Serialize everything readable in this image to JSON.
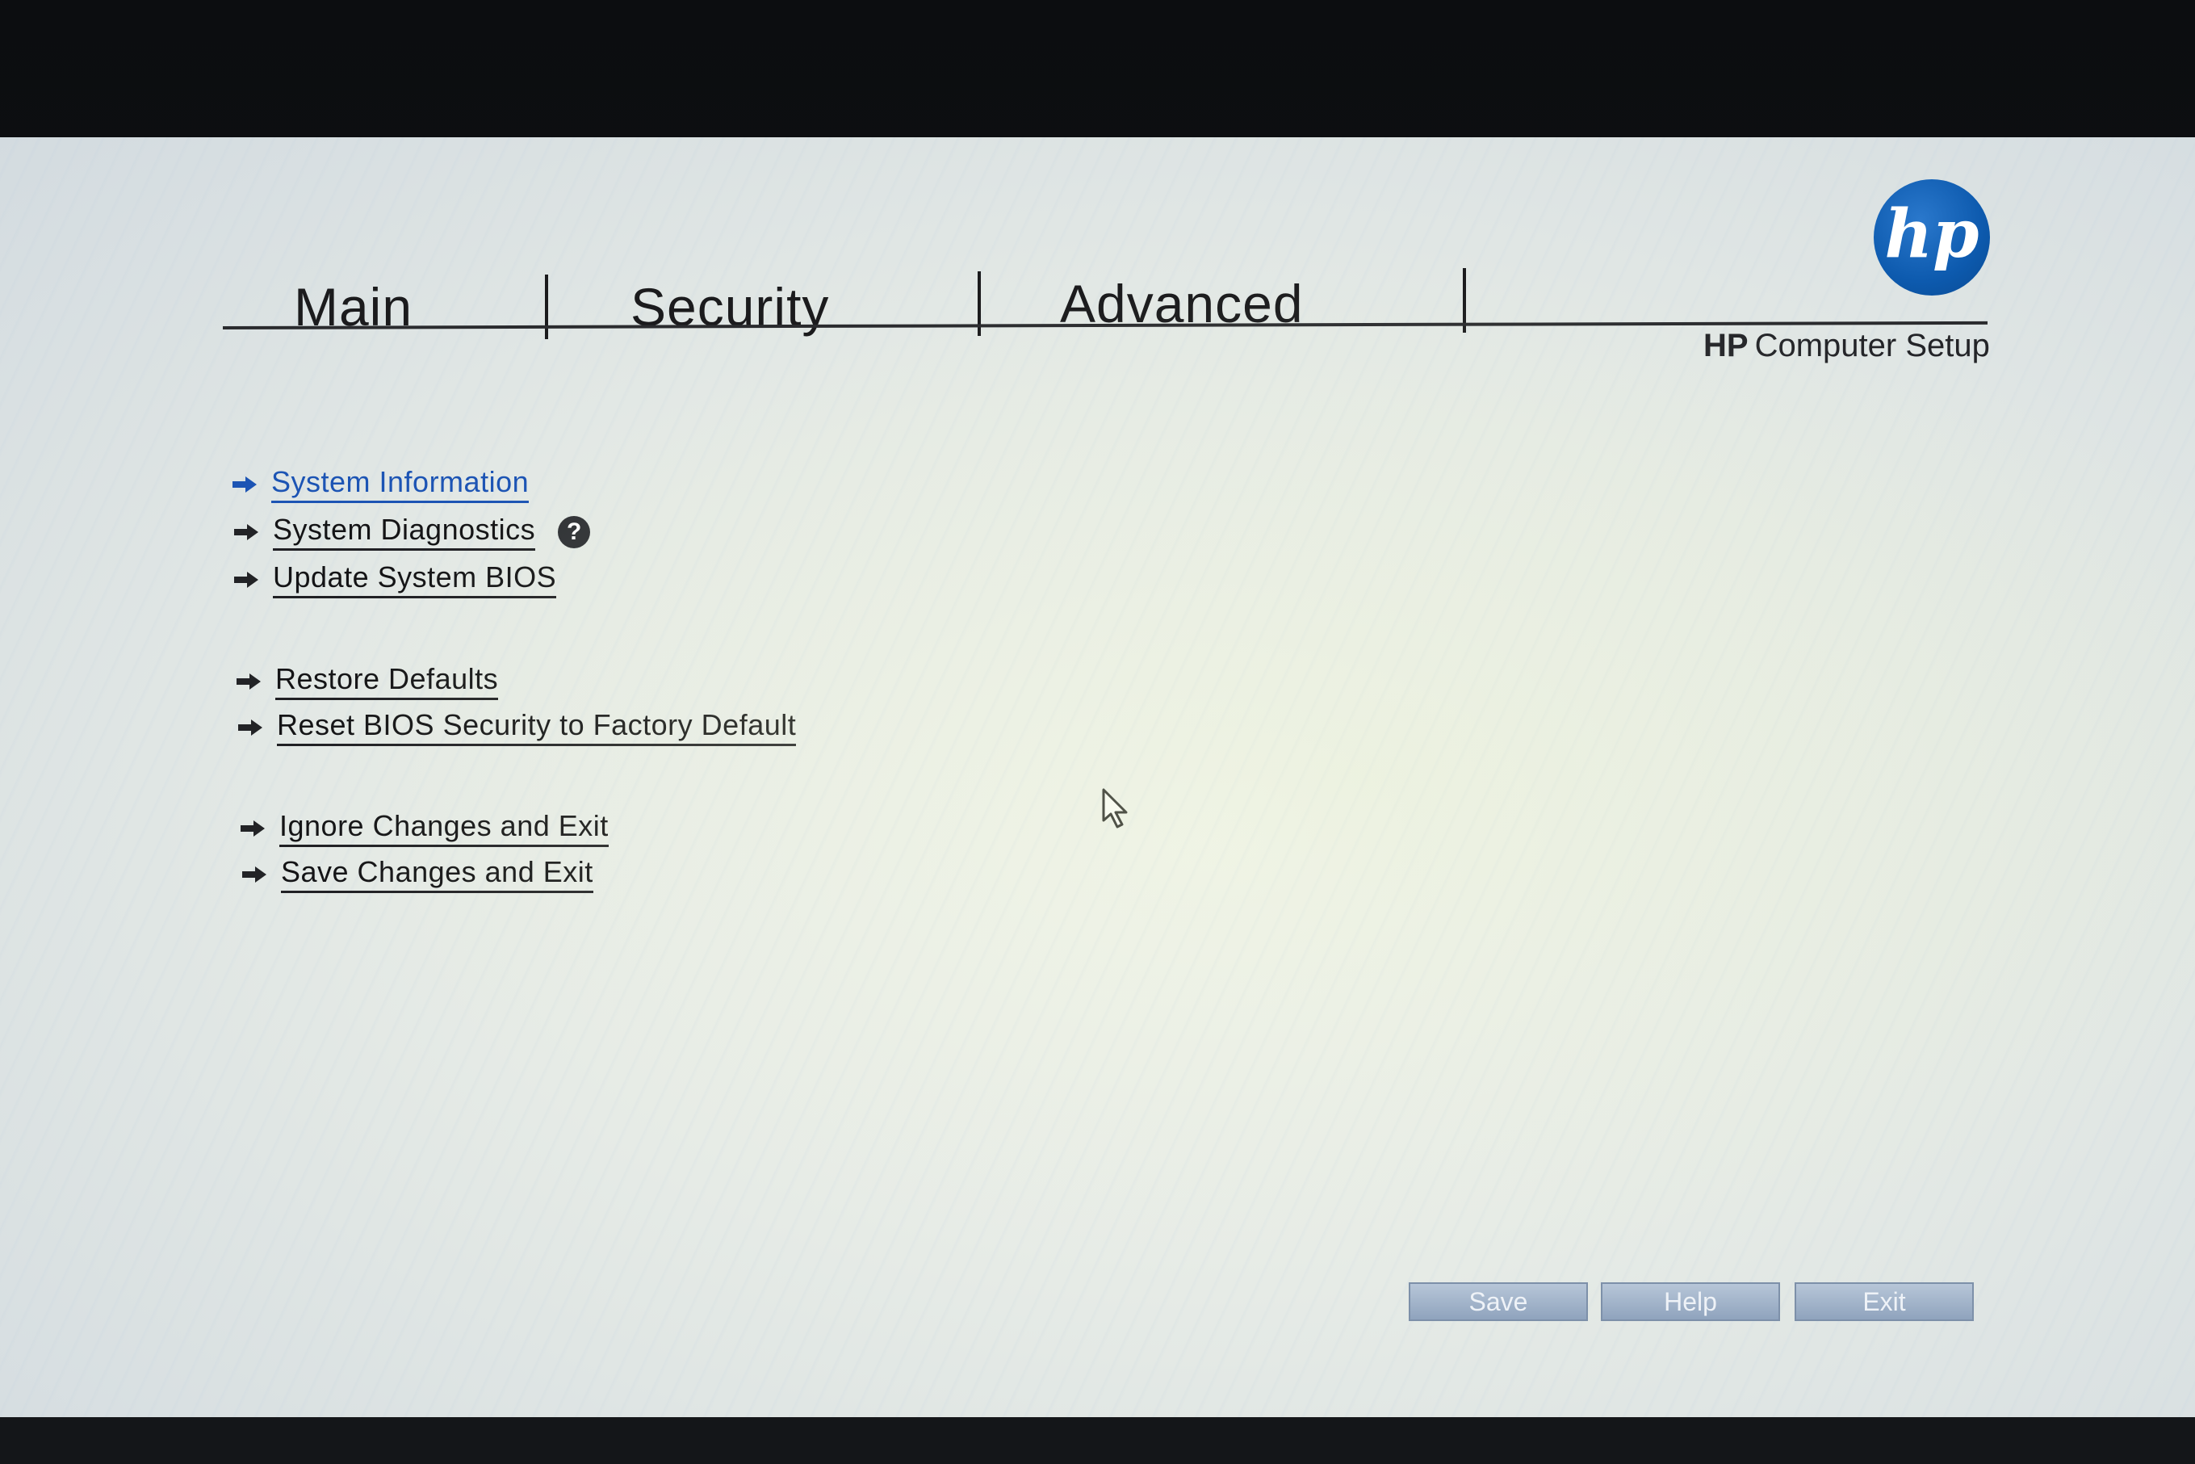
{
  "tabs": [
    {
      "label": "Main"
    },
    {
      "label": "Security"
    },
    {
      "label": "Advanced"
    }
  ],
  "header": {
    "brand": "HP",
    "product": "Computer Setup",
    "logo_text": "hp"
  },
  "menu": {
    "items": [
      {
        "label": "System Information",
        "active": true
      },
      {
        "label": "System Diagnostics",
        "help": "?"
      },
      {
        "label": "Update System BIOS"
      },
      {
        "label": "Restore Defaults"
      },
      {
        "label": "Reset BIOS Security to Factory Default"
      },
      {
        "label": "Ignore Changes and Exit"
      },
      {
        "label": "Save Changes and Exit"
      }
    ]
  },
  "buttons": {
    "save": "Save",
    "help": "Help",
    "exit": "Exit"
  },
  "icons": {
    "menu_arrow": "arrow-right-icon",
    "help": "question-circle-icon",
    "cursor": "mouse-pointer-icon",
    "logo": "hp-logo-icon"
  },
  "colors": {
    "accent_blue": "#1c54b4",
    "logo_blue": "#0d5aae",
    "text": "#141416",
    "button": "#a3b4ca"
  }
}
